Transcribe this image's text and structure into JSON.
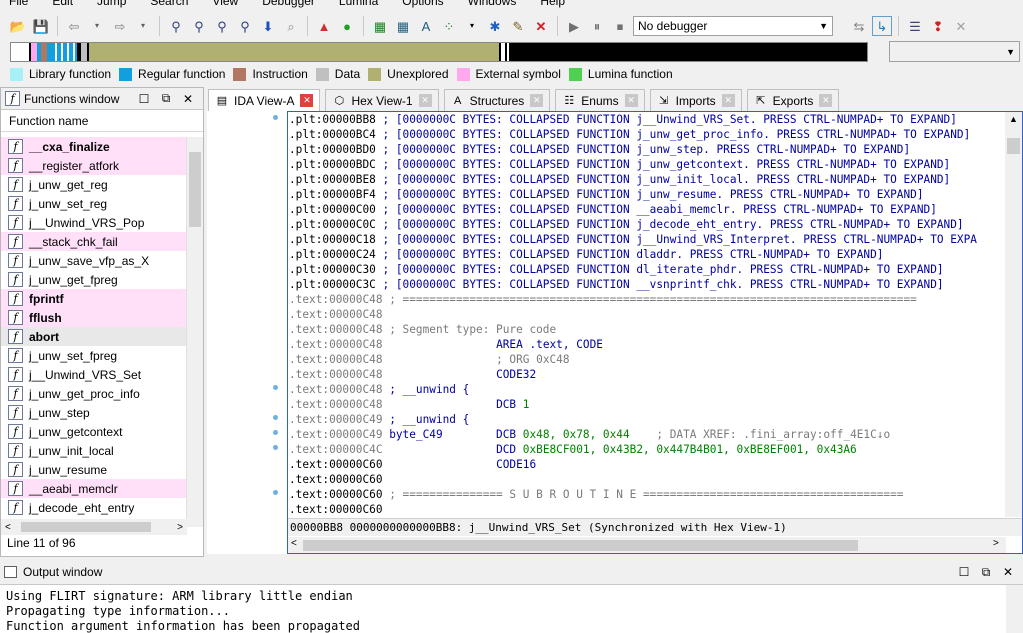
{
  "menu": [
    "File",
    "Edit",
    "Jump",
    "Search",
    "View",
    "Debugger",
    "Lumina",
    "Options",
    "Windows",
    "Help"
  ],
  "toolbar": {
    "debugger_select": "No debugger"
  },
  "legend": [
    {
      "label": "Library function",
      "color": "#a8f0f8"
    },
    {
      "label": "Regular function",
      "color": "#10a0e0"
    },
    {
      "label": "Instruction",
      "color": "#b07860"
    },
    {
      "label": "Data",
      "color": "#c0c0c0"
    },
    {
      "label": "Unexplored",
      "color": "#b0b070"
    },
    {
      "label": "External symbol",
      "color": "#ffa8f0"
    },
    {
      "label": "Lumina function",
      "color": "#50d050"
    }
  ],
  "functions_window": {
    "title": "Functions window",
    "column": "Function name",
    "status": "Line 11 of 96",
    "items": [
      {
        "name": "__cxa_finalize",
        "lib": true,
        "bold": true
      },
      {
        "name": "__register_atfork",
        "lib": true,
        "bold": false
      },
      {
        "name": "j_unw_get_reg",
        "lib": false,
        "bold": false
      },
      {
        "name": "j_unw_set_reg",
        "lib": false,
        "bold": false
      },
      {
        "name": "j__Unwind_VRS_Pop",
        "lib": false,
        "bold": false
      },
      {
        "name": "__stack_chk_fail",
        "lib": true,
        "bold": false
      },
      {
        "name": "j_unw_save_vfp_as_X",
        "lib": false,
        "bold": false
      },
      {
        "name": "j_unw_get_fpreg",
        "lib": false,
        "bold": false
      },
      {
        "name": "fprintf",
        "lib": true,
        "bold": true
      },
      {
        "name": "fflush",
        "lib": true,
        "bold": true
      },
      {
        "name": "abort",
        "lib": false,
        "bold": true,
        "sel": true
      },
      {
        "name": "j_unw_set_fpreg",
        "lib": false,
        "bold": false
      },
      {
        "name": "j__Unwind_VRS_Set",
        "lib": false,
        "bold": false
      },
      {
        "name": "j_unw_get_proc_info",
        "lib": false,
        "bold": false
      },
      {
        "name": "j_unw_step",
        "lib": false,
        "bold": false
      },
      {
        "name": "j_unw_getcontext",
        "lib": false,
        "bold": false
      },
      {
        "name": "j_unw_init_local",
        "lib": false,
        "bold": false
      },
      {
        "name": "j_unw_resume",
        "lib": false,
        "bold": false
      },
      {
        "name": "__aeabi_memclr",
        "lib": true,
        "bold": false
      },
      {
        "name": "j_decode_eht_entry",
        "lib": false,
        "bold": false
      }
    ]
  },
  "tabs": [
    {
      "label": "IDA View-A",
      "icon": "ida-view-icon",
      "active": true
    },
    {
      "label": "Hex View-1",
      "icon": "hex-view-icon",
      "active": false
    },
    {
      "label": "Structures",
      "icon": "structures-icon",
      "active": false
    },
    {
      "label": "Enums",
      "icon": "enums-icon",
      "active": false
    },
    {
      "label": "Imports",
      "icon": "imports-icon",
      "active": false
    },
    {
      "label": "Exports",
      "icon": "exports-icon",
      "active": false
    }
  ],
  "code_lines": [
    [
      [
        ".plt:00000BB8 ",
        "addr"
      ],
      [
        "; [0000000C BYTES: COLLAPSED FUNCTION j__Unwind_VRS_Set. PRESS CTRL-NUMPAD+ TO EXPAND]",
        "blue"
      ]
    ],
    [
      [
        ".plt:00000BC4 ",
        "addr"
      ],
      [
        "; [0000000C BYTES: COLLAPSED FUNCTION j_unw_get_proc_info. PRESS CTRL-NUMPAD+ TO EXPAND]",
        "blue"
      ]
    ],
    [
      [
        ".plt:00000BD0 ",
        "addr"
      ],
      [
        "; [0000000C BYTES: COLLAPSED FUNCTION j_unw_step. PRESS CTRL-NUMPAD+ TO EXPAND]",
        "blue"
      ]
    ],
    [
      [
        ".plt:00000BDC ",
        "addr"
      ],
      [
        "; [0000000C BYTES: COLLAPSED FUNCTION j_unw_getcontext. PRESS CTRL-NUMPAD+ TO EXPAND]",
        "blue"
      ]
    ],
    [
      [
        ".plt:00000BE8 ",
        "addr"
      ],
      [
        "; [0000000C BYTES: COLLAPSED FUNCTION j_unw_init_local. PRESS CTRL-NUMPAD+ TO EXPAND]",
        "blue"
      ]
    ],
    [
      [
        ".plt:00000BF4 ",
        "addr"
      ],
      [
        "; [0000000C BYTES: COLLAPSED FUNCTION j_unw_resume. PRESS CTRL-NUMPAD+ TO EXPAND]",
        "blue"
      ]
    ],
    [
      [
        ".plt:00000C00 ",
        "addr"
      ],
      [
        "; [0000000C BYTES: COLLAPSED FUNCTION __aeabi_memclr. PRESS CTRL-NUMPAD+ TO EXPAND]",
        "blue"
      ]
    ],
    [
      [
        ".plt:00000C0C ",
        "addr"
      ],
      [
        "; [0000000C BYTES: COLLAPSED FUNCTION j_decode_eht_entry. PRESS CTRL-NUMPAD+ TO EXPAND]",
        "blue"
      ]
    ],
    [
      [
        ".plt:00000C18 ",
        "addr"
      ],
      [
        "; [0000000C BYTES: COLLAPSED FUNCTION j__Unwind_VRS_Interpret. PRESS CTRL-NUMPAD+ TO EXPA",
        "blue"
      ]
    ],
    [
      [
        ".plt:00000C24 ",
        "addr"
      ],
      [
        "; [0000000C BYTES: COLLAPSED FUNCTION dladdr. PRESS CTRL-NUMPAD+ TO EXPAND]",
        "blue"
      ]
    ],
    [
      [
        ".plt:00000C30 ",
        "addr"
      ],
      [
        "; [0000000C BYTES: COLLAPSED FUNCTION dl_iterate_phdr. PRESS CTRL-NUMPAD+ TO EXPAND]",
        "blue"
      ]
    ],
    [
      [
        ".plt:00000C3C ",
        "addr"
      ],
      [
        "; [0000000C BYTES: COLLAPSED FUNCTION __vsnprintf_chk. PRESS CTRL-NUMPAD+ TO EXPAND]",
        "blue"
      ]
    ],
    [
      [
        ".text:00000C48 ",
        "gray"
      ],
      [
        "; =============================================================================",
        "gray"
      ]
    ],
    [
      [
        ".text:00000C48",
        "gray"
      ]
    ],
    [
      [
        ".text:00000C48 ",
        "gray"
      ],
      [
        "; Segment type: Pure code",
        "gray"
      ]
    ],
    [
      [
        ".text:00000C48                 ",
        "gray"
      ],
      [
        "AREA .text, CODE",
        "blue"
      ]
    ],
    [
      [
        ".text:00000C48                 ",
        "gray"
      ],
      [
        "; ORG 0xC48",
        "gray"
      ]
    ],
    [
      [
        ".text:00000C48                 ",
        "gray"
      ],
      [
        "CODE32",
        "blue"
      ]
    ],
    [
      [
        ".text:00000C48 ",
        "gray"
      ],
      [
        "; __unwind {",
        "blue"
      ]
    ],
    [
      [
        ".text:00000C48                 ",
        "gray"
      ],
      [
        "DCB ",
        "blue"
      ],
      [
        "1",
        "green"
      ]
    ],
    [
      [
        ".text:00000C49 ",
        "gray"
      ],
      [
        "; __unwind {",
        "blue"
      ]
    ],
    [
      [
        ".text:00000C49 ",
        "gray"
      ],
      [
        "byte_C49",
        "blue"
      ],
      [
        "        DCB ",
        "blue"
      ],
      [
        "0x48, 0x78, 0x44",
        "green"
      ],
      [
        "    ; DATA XREF: .fini_array:off_4E1C↓o",
        "gray"
      ]
    ],
    [
      [
        ".text:00000C4C                 ",
        "gray"
      ],
      [
        "DCD ",
        "blue"
      ],
      [
        "0xBE8CF001, 0x43B2, 0x447B4B01, 0xBE8EF001, 0x43A6",
        "green"
      ]
    ],
    [
      [
        ".text:00000C60                 ",
        "addr"
      ],
      [
        "CODE16",
        "blue"
      ]
    ],
    [
      [
        ".text:00000C60",
        "addr"
      ]
    ],
    [
      [
        ".text:00000C60 ",
        "addr"
      ],
      [
        "; =============== S U B R O U T I N E =======================================",
        "gray"
      ]
    ],
    [
      [
        ".text:00000C60",
        "addr"
      ]
    ]
  ],
  "editor_status": "00000BB8 0000000000000BB8: j__Unwind_VRS_Set (Synchronized with Hex View-1)",
  "output_window": {
    "title": "Output window",
    "lines": [
      "Using FLIRT signature: ARM library little endian",
      "Propagating type information...",
      "Function argument information has been propagated"
    ]
  }
}
